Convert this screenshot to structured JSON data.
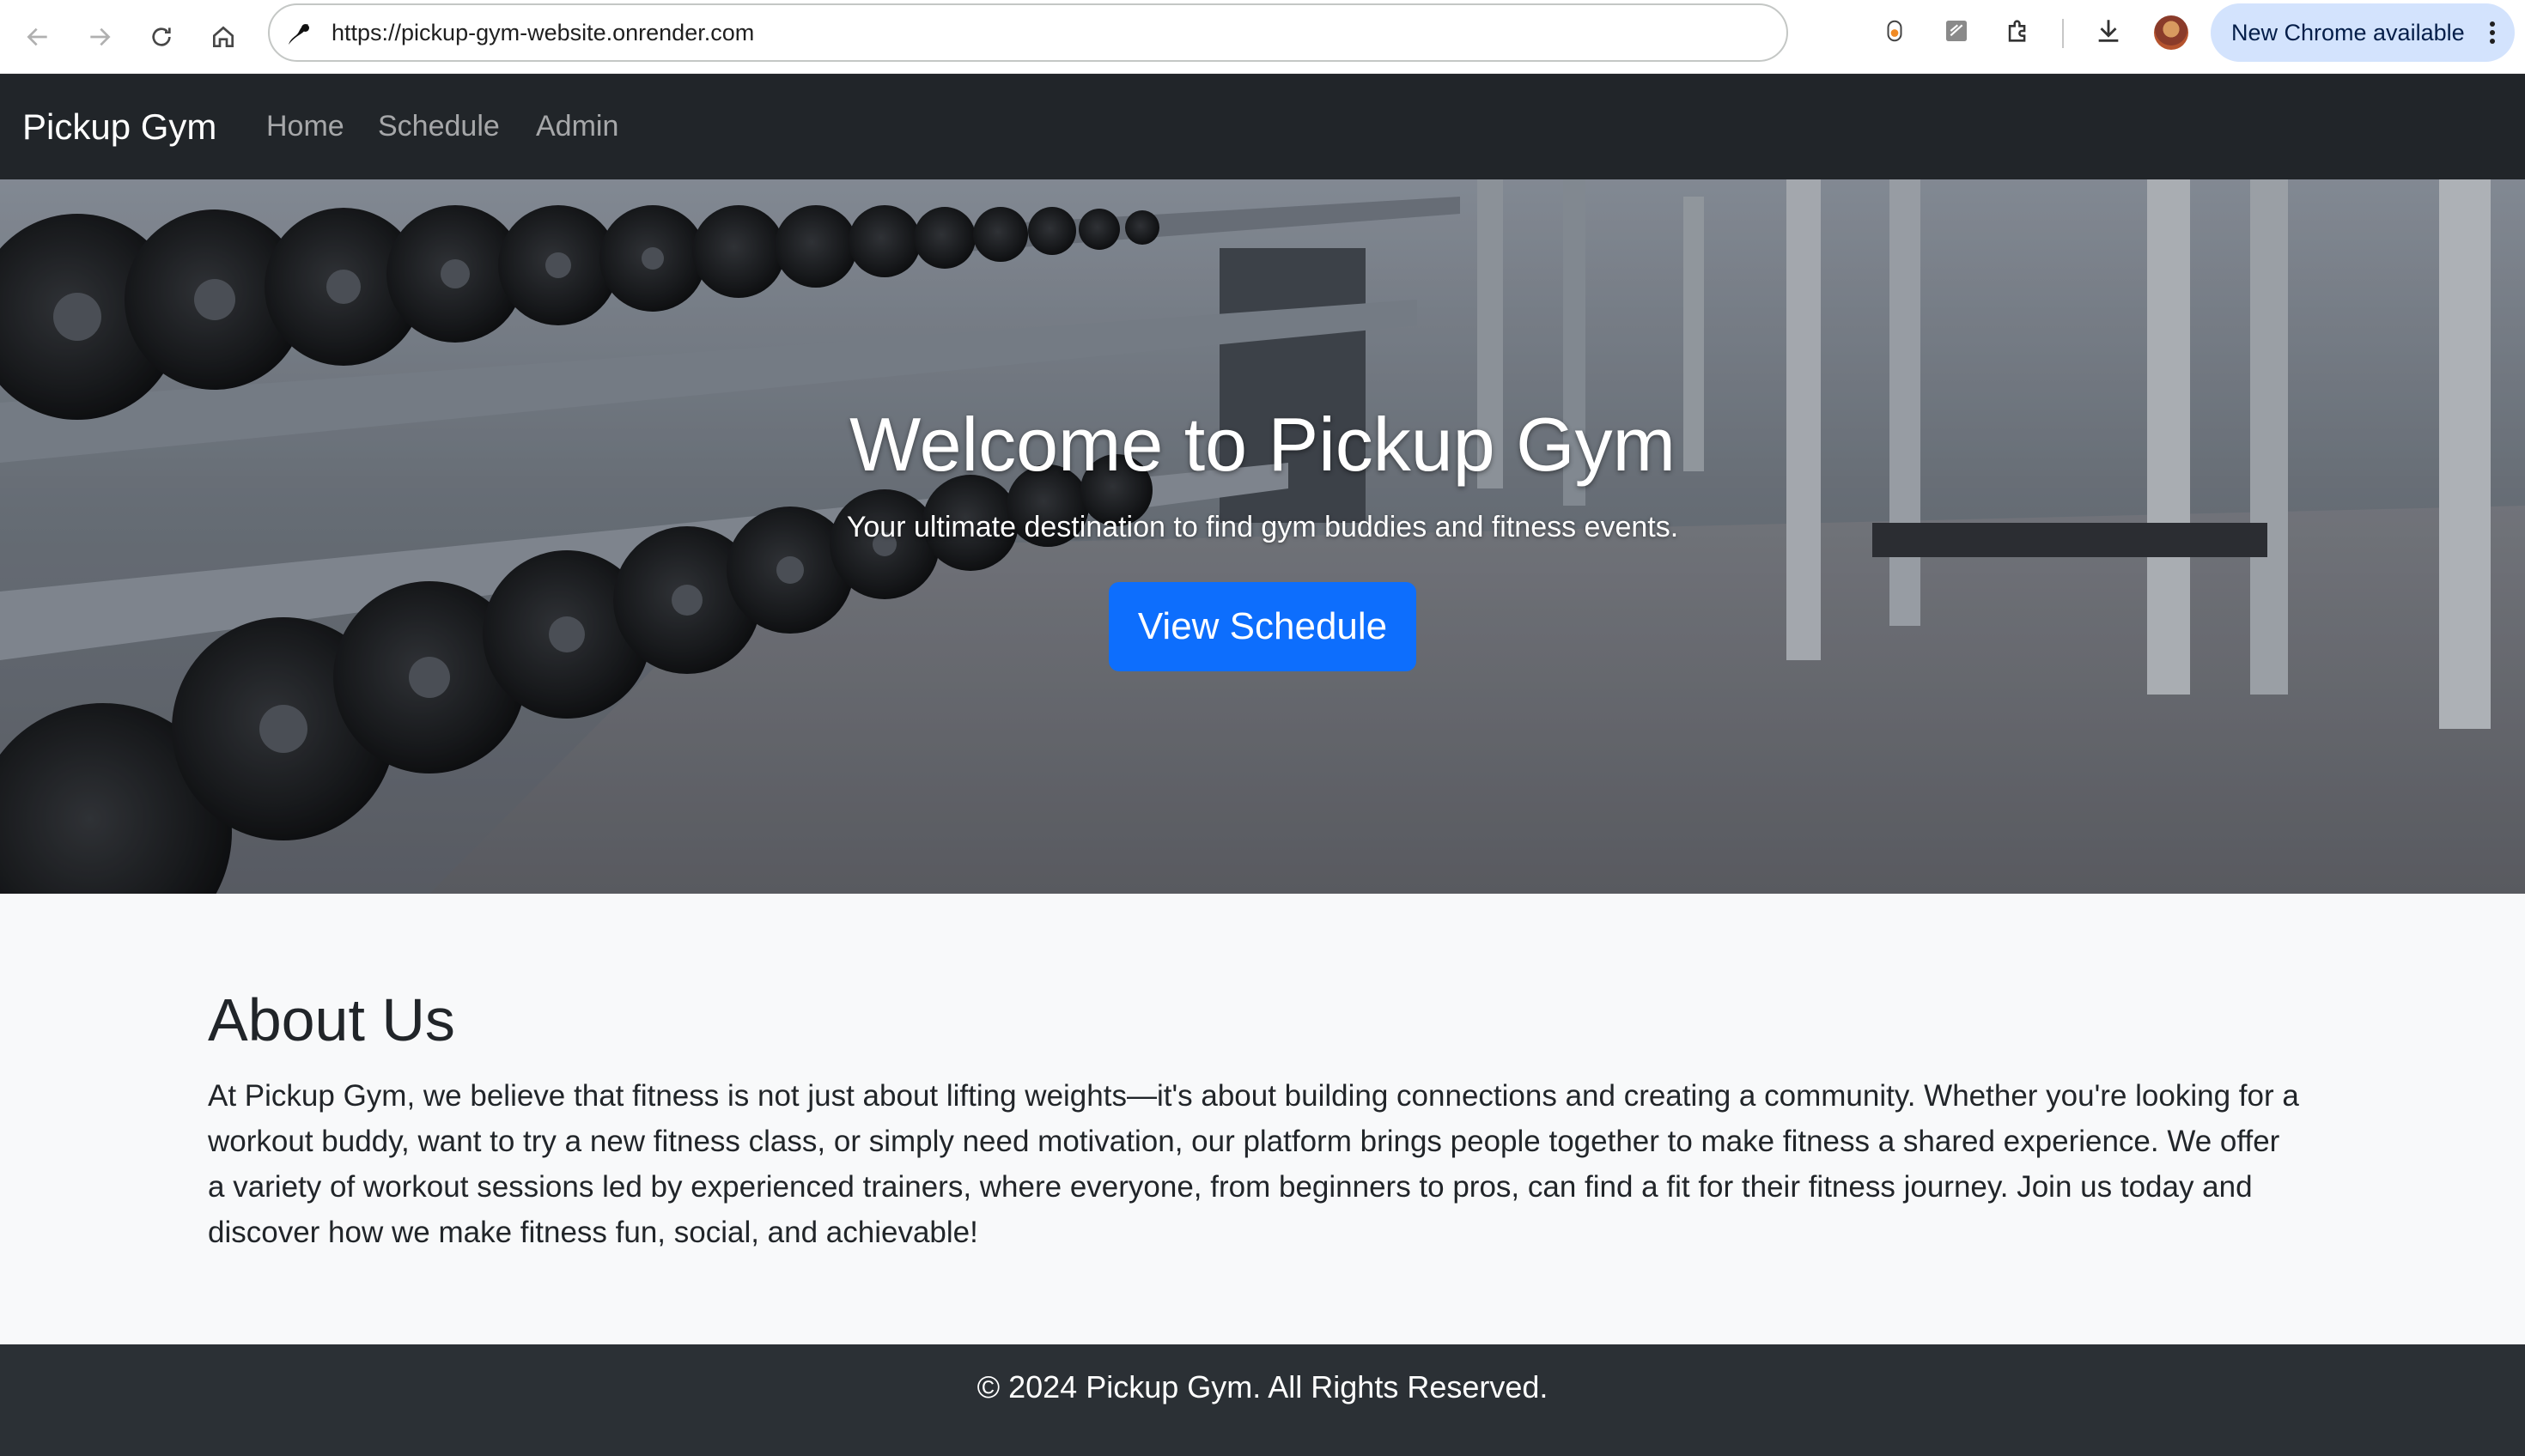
{
  "browser": {
    "url": "https://pickup-gym-website.onrender.com",
    "update_chip_label": "New Chrome available",
    "icons": [
      "back-icon",
      "forward-icon",
      "reload-icon",
      "home-icon",
      "site-info-icon",
      "extension-icon",
      "sidebar-extension-icon",
      "puzzle-extensions-icon",
      "download-icon",
      "avatar",
      "kebab-menu-icon"
    ]
  },
  "navbar": {
    "brand": "Pickup Gym",
    "links": [
      "Home",
      "Schedule",
      "Admin"
    ]
  },
  "hero": {
    "title": "Welcome to Pickup Gym",
    "subtitle": "Your ultimate destination to find gym buddies and fitness events.",
    "button_label": "View Schedule"
  },
  "about": {
    "title": "About Us",
    "text": "At Pickup Gym, we believe that fitness is not just about lifting weights—it's about building connections and creating a community. Whether you're looking for a workout buddy, want to try a new fitness class, or simply need motivation, our platform brings people together to make fitness a shared experience. We offer a variety of workout sessions led by experienced trainers, where everyone, from beginners to pros, can find a fit for their fitness journey. Join us today and discover how we make fitness fun, social, and achievable!"
  },
  "footer": {
    "text": "© 2024 Pickup Gym. All Rights Reserved."
  },
  "colors": {
    "navbar_bg": "#212529",
    "primary": "#0d6efd",
    "page_bg": "#f8f9fa",
    "footer_bg": "#2b3035"
  }
}
